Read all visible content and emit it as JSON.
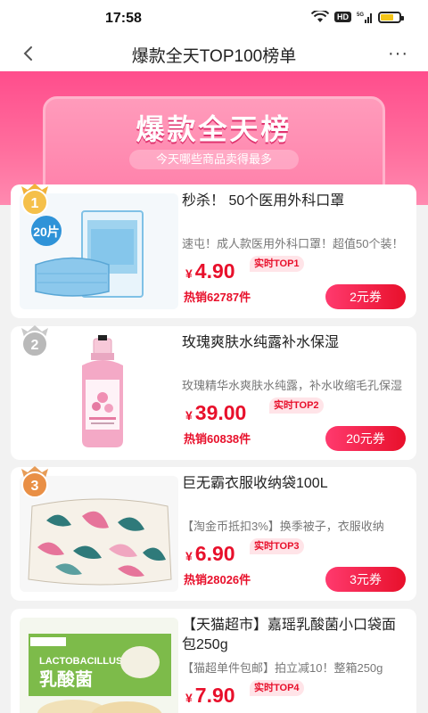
{
  "status_bar": {
    "time": "17:58",
    "icons": [
      "wifi-icon",
      "hd-icon",
      "signal-5g-icon",
      "battery-icon"
    ],
    "hd_label": "HD",
    "network_label": "5G"
  },
  "nav": {
    "title": "爆款全天TOP100榜单",
    "back_icon": "chevron-left-icon",
    "more_icon": "more-dots-icon",
    "more_label": "···"
  },
  "banner": {
    "title": "爆款全天榜",
    "subtitle": "今天哪些商品卖得最多"
  },
  "colors": {
    "accent": "#e8102b",
    "banner_pink": "#ff4d8c"
  },
  "products": [
    {
      "rank": "1",
      "title": "秒杀！ 50个医用外科口罩",
      "desc": "速屯！成人款医用外科口罩！超值50个装！",
      "price_sign": "¥",
      "price": "4.90",
      "top_tag": "实时TOP1",
      "sales": "热销62787件",
      "coupon": "2元券",
      "image_text": "20片"
    },
    {
      "rank": "2",
      "title": "玫瑰爽肤水纯露补水保湿",
      "desc": "玫瑰精华水爽肤水纯露，补水收缩毛孔保湿",
      "price_sign": "¥",
      "price": "39.00",
      "top_tag": "实时TOP2",
      "sales": "热销60838件",
      "coupon": "20元券"
    },
    {
      "rank": "3",
      "title": "巨无霸衣服收纳袋100L",
      "desc": "【淘金币抵扣3%】换季被子，衣服收纳",
      "price_sign": "¥",
      "price": "6.90",
      "top_tag": "实时TOP3",
      "sales": "热销28026件",
      "coupon": "3元券"
    },
    {
      "rank": "4",
      "title": "【天猫超市】嘉瑶乳酸菌小口袋面包250g",
      "desc": "【猫超单件包邮】拍立减10！整箱250g",
      "price_sign": "¥",
      "price": "7.90",
      "top_tag": "实时TOP4",
      "image_text_1": "LACTOBACILLUS",
      "image_text_2": "乳酸菌"
    }
  ]
}
